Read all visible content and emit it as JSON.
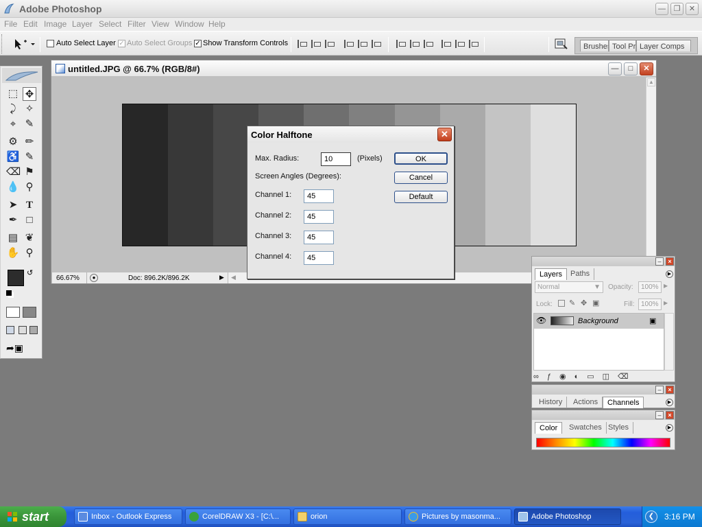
{
  "app": {
    "title": "Adobe Photoshop"
  },
  "menu": [
    "File",
    "Edit",
    "Image",
    "Layer",
    "Select",
    "Filter",
    "View",
    "Window",
    "Help"
  ],
  "options_bar": {
    "auto_select_layer": {
      "label": "Auto Select Layer",
      "checked": false
    },
    "auto_select_groups": {
      "label": "Auto Select Groups",
      "checked": true,
      "disabled": true
    },
    "show_transform_controls": {
      "label": "Show Transform Controls",
      "checked": true
    },
    "palette_well_tabs": [
      "Brushes",
      "Tool Pr",
      "Layer Comps"
    ]
  },
  "document": {
    "title": "untitled.JPG @ 66.7% (RGB/8#)",
    "zoom": "66.67%",
    "doc_size": "Doc: 896.2K/896.2K",
    "gray_bands": [
      "#272727",
      "#383838",
      "#474747",
      "#595959",
      "#6f6f6f",
      "#808080",
      "#959595",
      "#aaaaaa",
      "#c4c4c4",
      "#dfdfdf"
    ]
  },
  "dialog": {
    "title": "Color Halftone",
    "max_radius_label": "Max. Radius:",
    "max_radius_value": "10",
    "max_radius_unit": "(Pixels)",
    "screen_angles_label": "Screen Angles (Degrees):",
    "channels": [
      {
        "label": "Channel 1:",
        "value": "45"
      },
      {
        "label": "Channel 2:",
        "value": "45"
      },
      {
        "label": "Channel 3:",
        "value": "45"
      },
      {
        "label": "Channel 4:",
        "value": "45"
      }
    ],
    "ok_label": "OK",
    "cancel_label": "Cancel",
    "default_label": "Default"
  },
  "layers_palette": {
    "tabs": [
      "Layers",
      "Paths"
    ],
    "blend_mode": "Normal",
    "opacity_label": "Opacity:",
    "opacity_value": "100%",
    "lock_label": "Lock:",
    "fill_label": "Fill:",
    "fill_value": "100%",
    "layer_name": "Background"
  },
  "history_palette": {
    "tabs": [
      "History",
      "Actions",
      "Channels"
    ]
  },
  "color_palette": {
    "tabs": [
      "Color",
      "Swatches",
      "Styles"
    ]
  },
  "taskbar": {
    "start_label": "start",
    "buttons": [
      {
        "label": "Inbox - Outlook Express",
        "icon": "outlook-express-icon"
      },
      {
        "label": "CorelDRAW X3 - [C:\\...",
        "icon": "coreldraw-icon"
      },
      {
        "label": "orion",
        "icon": "folder-icon"
      },
      {
        "label": "Pictures by masonma...",
        "icon": "internet-explorer-icon"
      },
      {
        "label": "Adobe Photoshop",
        "icon": "photoshop-icon"
      }
    ],
    "clock": "3:16 PM"
  }
}
